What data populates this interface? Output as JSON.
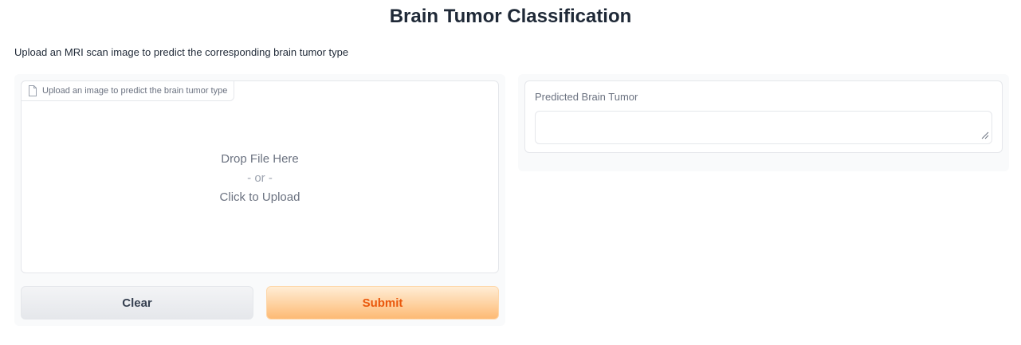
{
  "app": {
    "title": "Brain Tumor Classification",
    "description": "Upload an MRI scan image to predict the corresponding brain tumor type"
  },
  "input_panel": {
    "upload": {
      "label": "Upload an image to predict the brain tumor type",
      "icon": "file-icon",
      "drop_text": "Drop File Here",
      "or_text": "- or -",
      "click_text": "Click to Upload"
    },
    "clear_label": "Clear",
    "submit_label": "Submit"
  },
  "output_panel": {
    "label": "Predicted Brain Tumor",
    "value": ""
  },
  "colors": {
    "submit_text": "#ea580c",
    "submit_gradient_start": "#ffedd5",
    "submit_gradient_end": "#fdba74",
    "clear_gradient_start": "#f3f4f6",
    "clear_gradient_end": "#e5e7eb",
    "panel_background": "#f9fafb",
    "border": "#e5e7eb"
  }
}
